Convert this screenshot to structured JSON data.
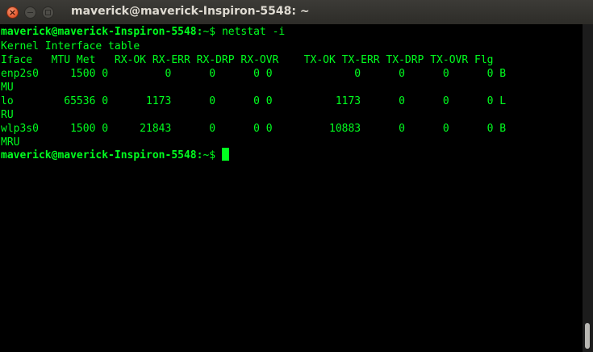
{
  "window": {
    "title": "maverick@maverick-Inspiron-5548: ~",
    "close_glyph": "×"
  },
  "terminal": {
    "prompt": {
      "user_host": "maverick@maverick-Inspiron-5548",
      "colon": ":",
      "path": "~$",
      "command": " netstat -i"
    },
    "output_lines": [
      "Kernel Interface table",
      "Iface   MTU Met   RX-OK RX-ERR RX-DRP RX-OVR    TX-OK TX-ERR TX-DRP TX-OVR Flg",
      "enp2s0     1500 0         0      0      0 0             0      0      0      0 B",
      "MU",
      "lo        65536 0      1173      0      0 0          1173      0      0      0 L",
      "RU",
      "wlp3s0     1500 0     21843      0      0 0         10883      0      0      0 B",
      "MRU"
    ],
    "final_prompt": {
      "user_host": "maverick@maverick-Inspiron-5548",
      "colon": ":",
      "path": "~$",
      "command": " "
    }
  },
  "colors": {
    "foreground": "#00ff1f",
    "background": "#000000",
    "titlebar": "#3c3b37",
    "close_button": "#e2552b"
  }
}
